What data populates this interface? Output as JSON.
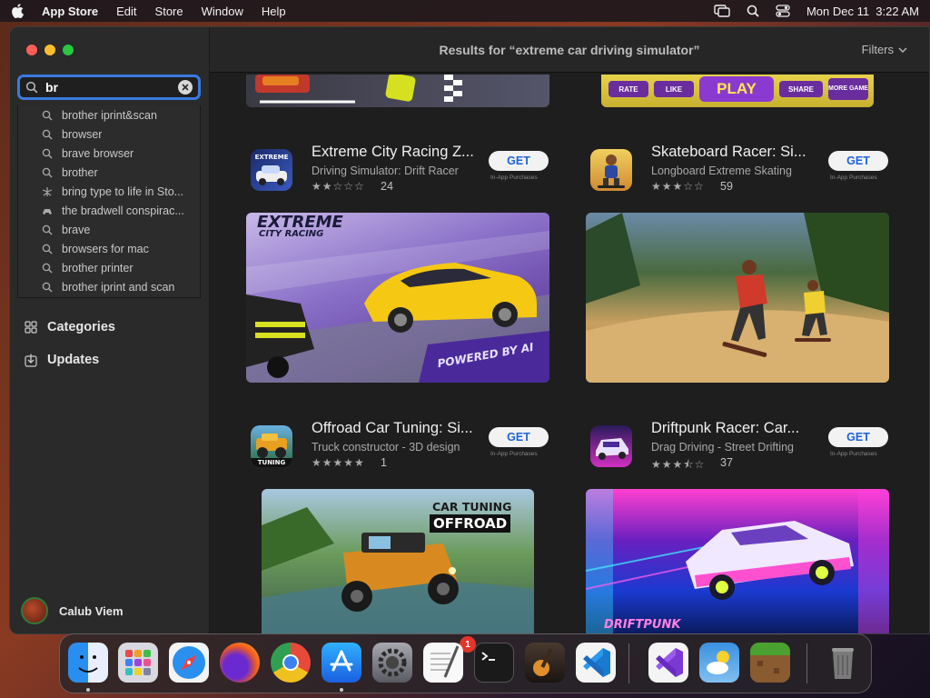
{
  "menubar": {
    "app_name": "App Store",
    "items": [
      "Edit",
      "Store",
      "Window",
      "Help"
    ],
    "clock": "Mon Dec 11  3:22 AM"
  },
  "search": {
    "value": "br",
    "suggestions": [
      {
        "text": "brother iprint&scan",
        "icon": "magnifier-icon"
      },
      {
        "text": "browser",
        "icon": "magnifier-icon"
      },
      {
        "text": "brave browser",
        "icon": "magnifier-icon"
      },
      {
        "text": "brother",
        "icon": "magnifier-icon"
      },
      {
        "text": "bring type to life in Sto...",
        "icon": "story-icon"
      },
      {
        "text": "the bradwell conspirac...",
        "icon": "game-icon"
      },
      {
        "text": "brave",
        "icon": "magnifier-icon"
      },
      {
        "text": "browsers for mac",
        "icon": "magnifier-icon"
      },
      {
        "text": "brother printer",
        "icon": "magnifier-icon"
      },
      {
        "text": "brother iprint and scan",
        "icon": "magnifier-icon"
      }
    ]
  },
  "sidebar": {
    "categories_label": "Categories",
    "updates_label": "Updates",
    "user_name": "Calub Viem"
  },
  "header": {
    "title": "Results for “extreme car driving simulator”",
    "filters_label": "Filters"
  },
  "top_banner_buttons": {
    "rate": "RATE",
    "like": "LIKE",
    "play": "PLAY",
    "share": "SHARE",
    "more": "MORE GAME"
  },
  "apps": [
    {
      "name": "Extreme City Racing Z...",
      "subtitle": "Driving Simulator: Drift Racer",
      "rating": 2,
      "rating_count": "24",
      "get_label": "GET",
      "iap_label": "In-App Purchases",
      "banner_title": "EXTREME",
      "banner_subtitle": "CITY RACING",
      "banner_tag": "POWERED BY AI"
    },
    {
      "name": "Skateboard Racer: Si...",
      "subtitle": "Longboard Extreme Skating",
      "rating": 3,
      "rating_count": "59",
      "get_label": "GET",
      "iap_label": "In-App Purchases"
    },
    {
      "name": "Offroad Car Tuning: Si...",
      "subtitle": "Truck constructor - 3D design",
      "rating": 5,
      "rating_count": "1",
      "get_label": "GET",
      "iap_label": "In-App Purchases",
      "icon_label": "TUNING",
      "banner_title": "CAR TUNING",
      "banner_subtitle": "OFFROAD"
    },
    {
      "name": "Driftpunk Racer: Car...",
      "subtitle": "Drag Driving - Street Drifting",
      "rating": 3.5,
      "rating_count": "37",
      "get_label": "GET",
      "iap_label": "In-App Purchases",
      "banner_title": "DRIFTPUNK"
    }
  ],
  "dock": {
    "apps": [
      "finder-icon",
      "launchpad-icon",
      "safari-icon",
      "firefox-icon",
      "chrome-icon",
      "app-store-icon",
      "system-settings-icon",
      "textedit-icon",
      "terminal-icon",
      "garageband-icon",
      "vscode-icon",
      "visual-studio-icon",
      "weather-icon",
      "minecraft-icon",
      "trash-icon"
    ],
    "settings_badge": "1"
  },
  "colors": {
    "accent": "#3b7ae0",
    "get_text": "#1c64d8"
  }
}
